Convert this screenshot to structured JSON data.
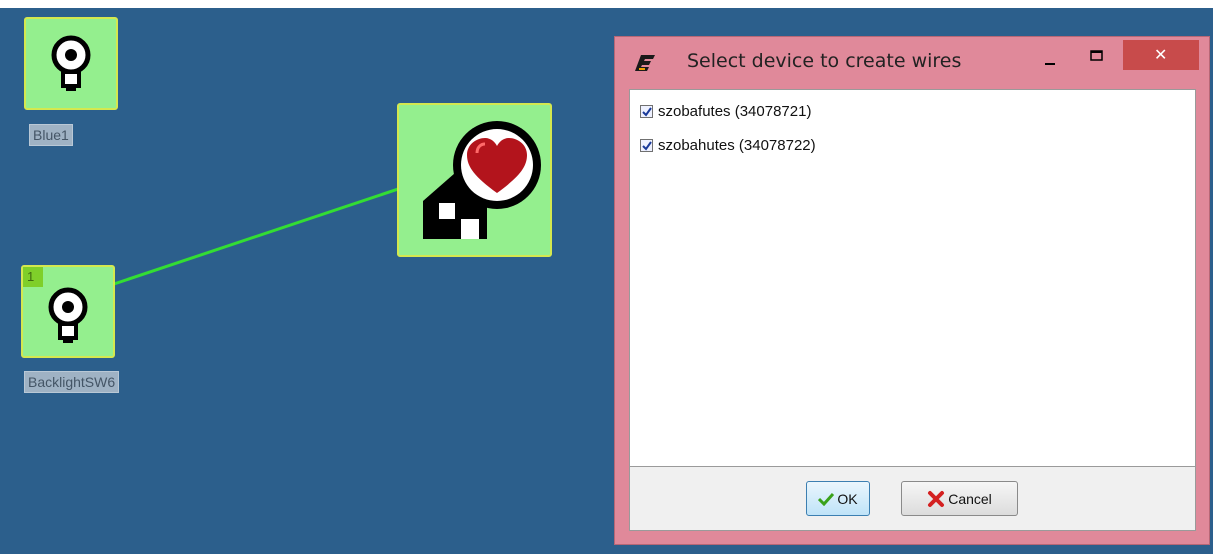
{
  "canvas": {
    "nodes": [
      {
        "id": "blue1",
        "label": "Blue1",
        "icon": "lightbulb-icon"
      },
      {
        "id": "heart-home",
        "label": "",
        "icon": "heart-home-icon"
      },
      {
        "id": "backlight",
        "label": "BacklightSW6",
        "icon": "lightbulb-icon",
        "badge": "1"
      }
    ],
    "wire_color": "#33dd33"
  },
  "dialog": {
    "title": "Select device to create wires",
    "items": [
      {
        "label": "szobafutes (34078721)",
        "checked": true
      },
      {
        "label": "szobahutes (34078722)",
        "checked": true
      }
    ],
    "ok_label": "OK",
    "cancel_label": "Cancel",
    "close_glyph": "✕"
  },
  "colors": {
    "canvas_bg": "#2c5f8c",
    "node_bg": "#94ef8e",
    "dialog_frame": "#e0899a",
    "close_btn": "#c84b4b"
  }
}
